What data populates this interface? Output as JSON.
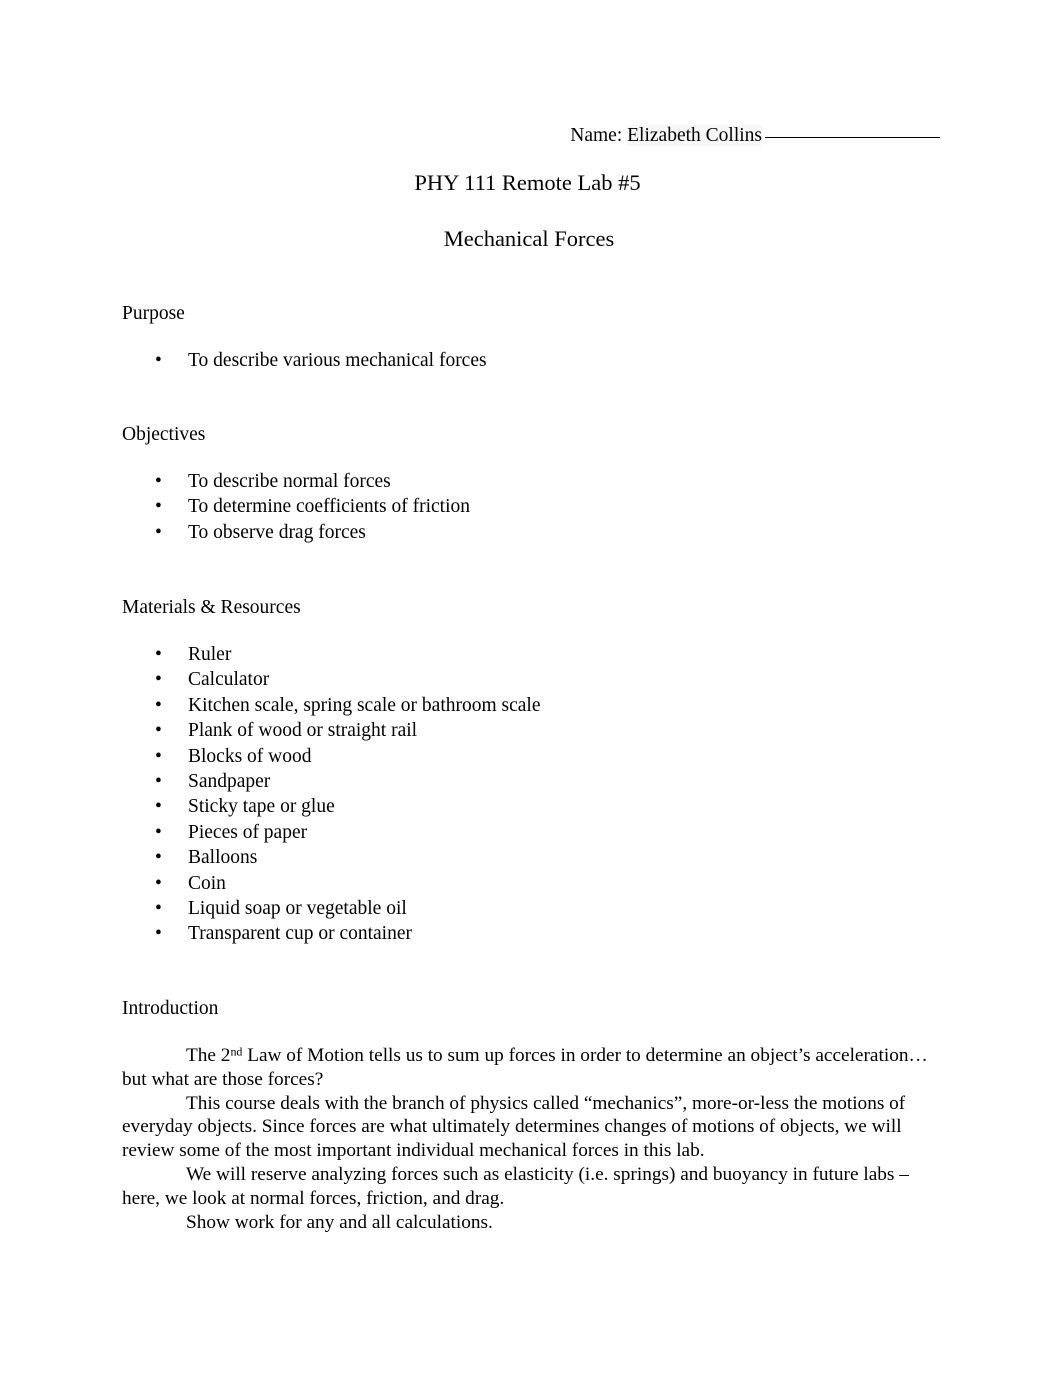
{
  "document": {
    "name_field": {
      "label": "Name:",
      "value": "Elizabeth Collins"
    },
    "title": "PHY 111 Remote Lab #5",
    "subtitle": "Mechanical Forces",
    "sections": {
      "purpose": {
        "heading": "Purpose",
        "items": [
          "To describe various mechanical forces"
        ]
      },
      "objectives": {
        "heading": "Objectives",
        "items": [
          "To describe normal forces",
          "To determine coefficients of friction",
          "To observe drag forces"
        ]
      },
      "materials": {
        "heading": "Materials & Resources",
        "items": [
          "Ruler",
          "Calculator",
          "Kitchen scale, spring scale or bathroom scale",
          "Plank of wood or straight rail",
          "Blocks of wood",
          "Sandpaper",
          "Sticky tape or glue",
          "Pieces of paper",
          "Balloons",
          "Coin",
          "Liquid soap or vegetable oil",
          "Transparent cup or container"
        ]
      },
      "introduction": {
        "heading": "Introduction",
        "paragraph_1_before_sup": "The 2",
        "paragraph_1_sup": "nd",
        "paragraph_1_after_sup": " Law of Motion tells us to sum up forces in order to determine an object’s acceleration… but what are those forces?",
        "paragraph_2": "This course deals with the branch of physics called “mechanics”, more-or-less the motions of everyday objects. Since forces are what ultimately determines changes of motions of objects, we will review some of the most important individual mechanical forces in this lab.",
        "paragraph_3": "We will reserve analyzing forces such as elasticity (i.e. springs) and buoyancy in future labs – here, we look at normal forces, friction, and drag.",
        "paragraph_4": "Show work for any and all calculations."
      }
    },
    "bullet_glyph": "•"
  }
}
